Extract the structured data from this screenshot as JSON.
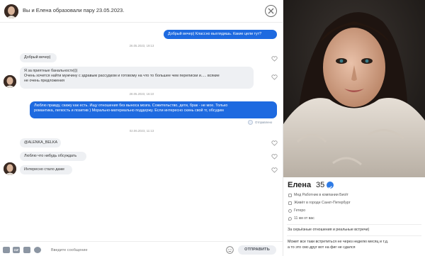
{
  "header": {
    "title": "Вы и Елена образовали пару 23.05.2023."
  },
  "messages": [
    {
      "text": "Добрый вечер) Классно выглядишь. Какие цели тут?"
    },
    {
      "date": "26.05.2023, 19:13"
    },
    {
      "text": "Добрый вечер)"
    },
    {
      "text_line1": "Я за приятные банальности)))",
      "text_line2": "Очень хочется найти мужчину с здравым рассудком и готовому на что то большее чем переписки и..... всякие",
      "text_line3": "не очень предложения"
    },
    {
      "date": "28.05.2023, 16:10"
    },
    {
      "text_line1": "Люблю правду, скажу как есть. Ищу отношения без выноса мозга. Сожительство, дети, брак - не мое. Только",
      "text_line2": "романтика, легкость и позитив ) Морально-материально поддержу. Если интересно скинь свой тг, обсудим",
      "status": "Отправлено"
    },
    {
      "date": "02.06.2023, 11:13"
    },
    {
      "text": "@ALENKA_BELKA"
    },
    {
      "text": "Люблю что нибудь обсуждать"
    },
    {
      "text": "Интересно стало даже"
    }
  ],
  "footer": {
    "placeholder": "Введите сообщение",
    "send_label": "ОТПРАВИТЬ",
    "gif_label": "GIF"
  },
  "profile": {
    "name": "Елена",
    "age": "35",
    "info": [
      {
        "icon": "briefcase-icon",
        "text": "Мед Работник в компании Биоlт"
      },
      {
        "icon": "home-icon",
        "text": "Живёт в городе Санкт-Петербург"
      },
      {
        "icon": "orientation-icon",
        "text": "Гетеро"
      },
      {
        "icon": "location-icon",
        "text": "11 км от вас"
      }
    ],
    "goal": "За серьёзные отношения и реальные встречи)",
    "about_line1": "Может все таки встретиться не через неделю месяц и т.д.",
    "about_line2": "а то это смс-друг вот на фиг не сдался"
  },
  "colors": {
    "accent": "#1e6ae0",
    "incoming": "#eef0f3",
    "verified": "#2f7be5"
  }
}
